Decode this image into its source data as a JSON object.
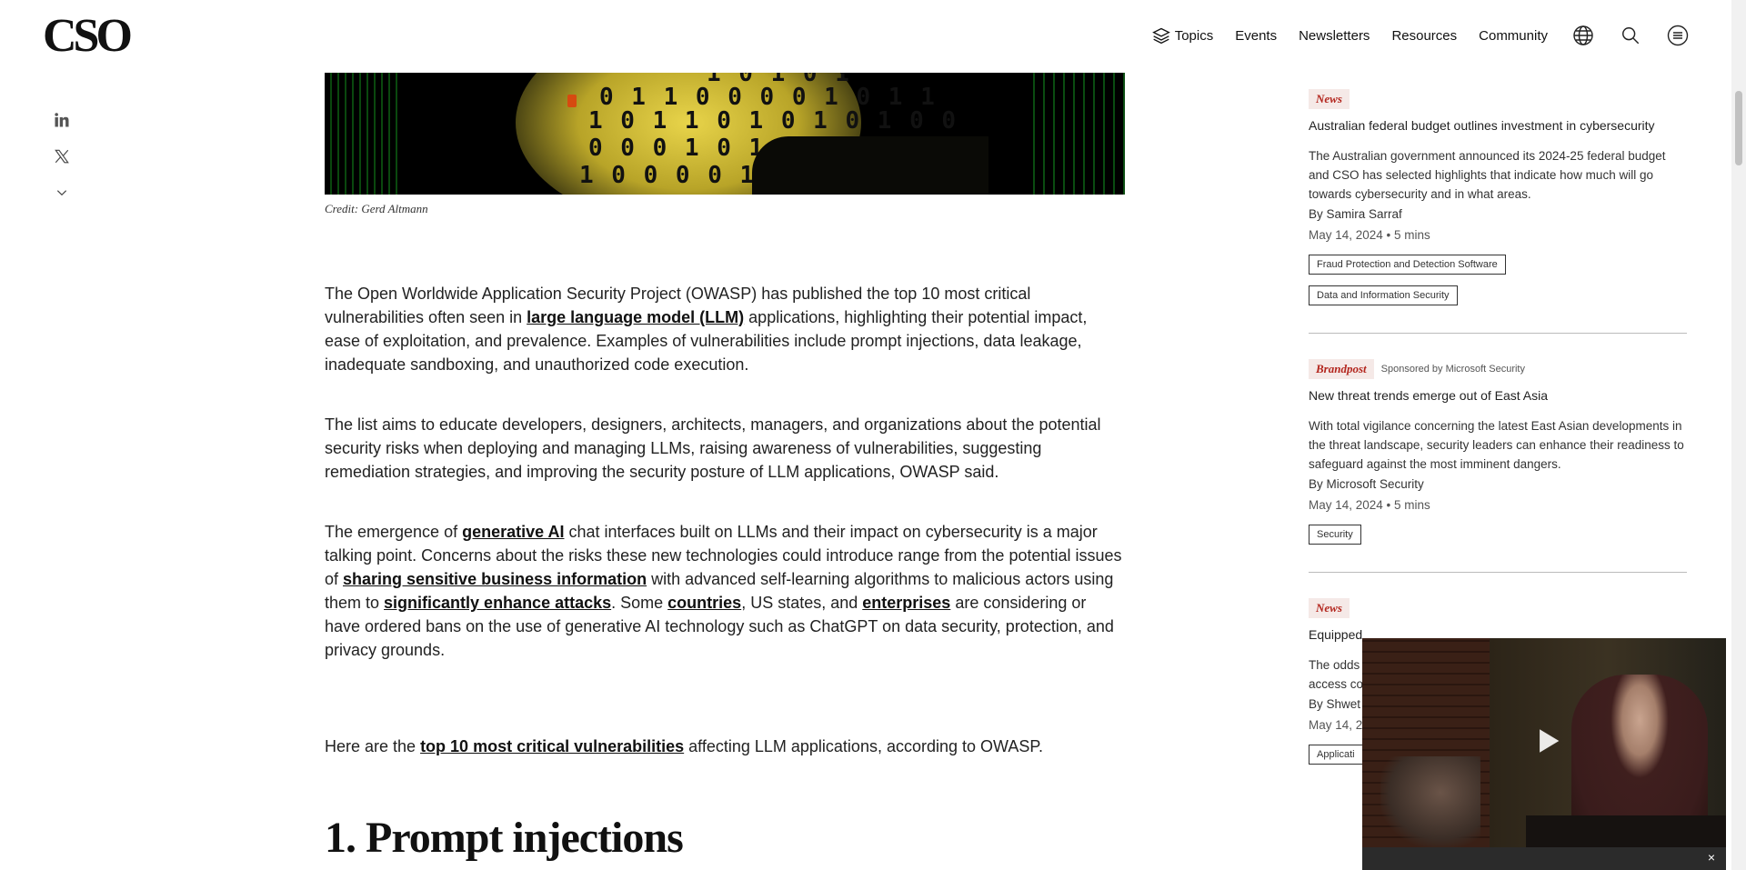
{
  "header": {
    "logo": "CSO",
    "nav": [
      "Topics",
      "Events",
      "Newsletters",
      "Resources",
      "Community"
    ],
    "icons": [
      "globe-icon",
      "search-icon",
      "menu-icon"
    ]
  },
  "share": {
    "icons": [
      "linkedin-icon",
      "x-icon",
      "chevron-down-icon"
    ]
  },
  "article": {
    "credit": "Credit: Gerd Altmann",
    "hero_binary": [
      "1 0 1 0 1",
      "0 1 1 0 0 0 0 1 0 1 1",
      "1 0 1 1 0 1 0 1 0 1 0 0",
      "0 0 0 1 0 1",
      "1 0 0 0 0 1 0"
    ],
    "p1": {
      "a": "The Open Worldwide Application Security Project (OWASP) has published the top 10 most critical vulnerabilities often seen in ",
      "link": "large language model (LLM)",
      "b": " applications, highlighting their potential impact, ease of exploitation, and prevalence. Examples of vulnerabilities include prompt injections, data leakage, inadequate sandboxing, and unauthorized code execution."
    },
    "p2": "The list aims to educate developers, designers, architects, managers, and organizations about the potential security risks when deploying and managing LLMs, raising awareness of vulnerabilities, suggesting remediation strategies, and improving the security posture of LLM applications, OWASP said.",
    "p3": {
      "a": "The emergence of ",
      "link1": "generative AI",
      "b": " chat interfaces built on LLMs and their impact on cybersecurity is a major talking point. Concerns about the risks these new technologies could introduce range from the potential issues of ",
      "link2": "sharing sensitive business information",
      "c": " with advanced self-learning algorithms to malicious actors using them to ",
      "link3": "significantly enhance attacks",
      "d": ". Some ",
      "link4": "countries",
      "e": ", US states, and ",
      "link5": "enterprises",
      "f": " are considering or have ordered bans on the use of generative AI technology such as ChatGPT on data security, protection, and privacy grounds."
    },
    "p4": {
      "a": "Here are the ",
      "link": "top 10 most critical vulnerabilities",
      "b": " affecting LLM applications, according to OWASP."
    },
    "h2": "1. Prompt injections"
  },
  "sidebar": {
    "cards": [
      {
        "kind": "News",
        "title": "Australian federal budget outlines investment in cybersecurity",
        "desc": "The Australian government announced its 2024-25 federal budget and CSO has selected highlights that indicate how much will go towards cybersecurity and in what areas.",
        "by": "By Samira Sarraf",
        "meta": "May 14, 2024  •  5 mins",
        "chips": [
          "Fraud Protection and Detection Software",
          "Data and Information Security"
        ]
      },
      {
        "kind": "Brandpost",
        "sponsor": "Sponsored by Microsoft Security",
        "title": "New threat trends emerge out of East Asia",
        "desc": "With total vigilance concerning the latest East Asian developments in the threat landscape, security leaders can enhance their readiness to safeguard against the most imminent dangers.",
        "by": "By Microsoft Security",
        "meta": "May 14, 2024  •  5 mins",
        "chips": [
          "Security"
        ]
      },
      {
        "kind": "News",
        "title": "Equipped",
        "desc_lines": [
          "The odds",
          "access co"
        ],
        "by": "By Shwet",
        "meta": "May 14, 2",
        "chips": [
          "Applicati"
        ]
      }
    ]
  },
  "video": {
    "close": "×"
  }
}
